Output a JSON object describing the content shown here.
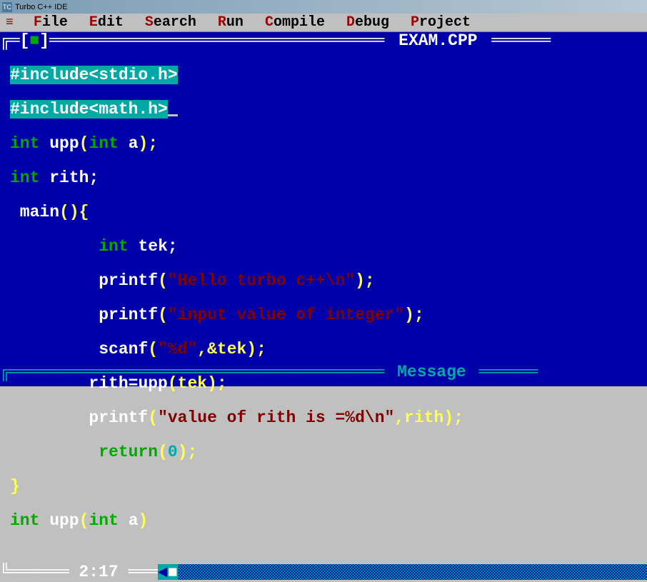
{
  "window": {
    "title": "Turbo C++ IDE"
  },
  "menu": {
    "items": [
      {
        "hotkey": "F",
        "rest": "ile"
      },
      {
        "hotkey": "E",
        "rest": "dit"
      },
      {
        "hotkey": "S",
        "rest": "earch"
      },
      {
        "hotkey": "R",
        "rest": "un"
      },
      {
        "hotkey": "C",
        "rest": "ompile"
      },
      {
        "hotkey": "D",
        "rest": "ebug"
      },
      {
        "hotkey": "P",
        "rest": "roject"
      }
    ]
  },
  "editor": {
    "filename": "EXAM.CPP",
    "status_position": "2:17",
    "code": {
      "l1_inc": "#include<stdio.h>",
      "l2_inc": "#include<math.h>",
      "l3_int": "int",
      "l3_upp": "upp",
      "l3_open": "(",
      "l3_int2": "int",
      "l3_a": "a",
      "l3_close": ");",
      "l4_int": "int",
      "l4_rith": "rith;",
      "l5_main": " main",
      "l5_brace": "(){",
      "l6_int": "int",
      "l6_tek": "tek;",
      "l7_printf": "printf",
      "l7_p1": "(",
      "l7_str": "\"Hello turbo c++\\n\"",
      "l7_p2": ");",
      "l8_printf": "printf",
      "l8_p1": "(",
      "l8_str": "\"input value of integer\"",
      "l8_p2": ");",
      "l9_scanf": "scanf",
      "l9_p1": "(",
      "l9_str": "\"%d\"",
      "l9_comma": ",&tek",
      "l9_p2": ");",
      "l10_rith": "rith=",
      "l10_upp": "upp",
      "l10_args": "(tek);",
      "l11_printf": "printf",
      "l11_p1": "(",
      "l11_str": "\"value of rith is =%d\\n\"",
      "l11_comma": ",rith",
      "l11_p2": ");",
      "l12_return": "return",
      "l12_args": "(",
      "l12_zero": "0",
      "l12_close": ");",
      "l13_brace": "}",
      "l14_int": "int",
      "l14_upp": "upp",
      "l14_p1": "(",
      "l14_int2": "int",
      "l14_a": "a",
      "l14_p2": ")"
    }
  },
  "message": {
    "title": "Message"
  }
}
